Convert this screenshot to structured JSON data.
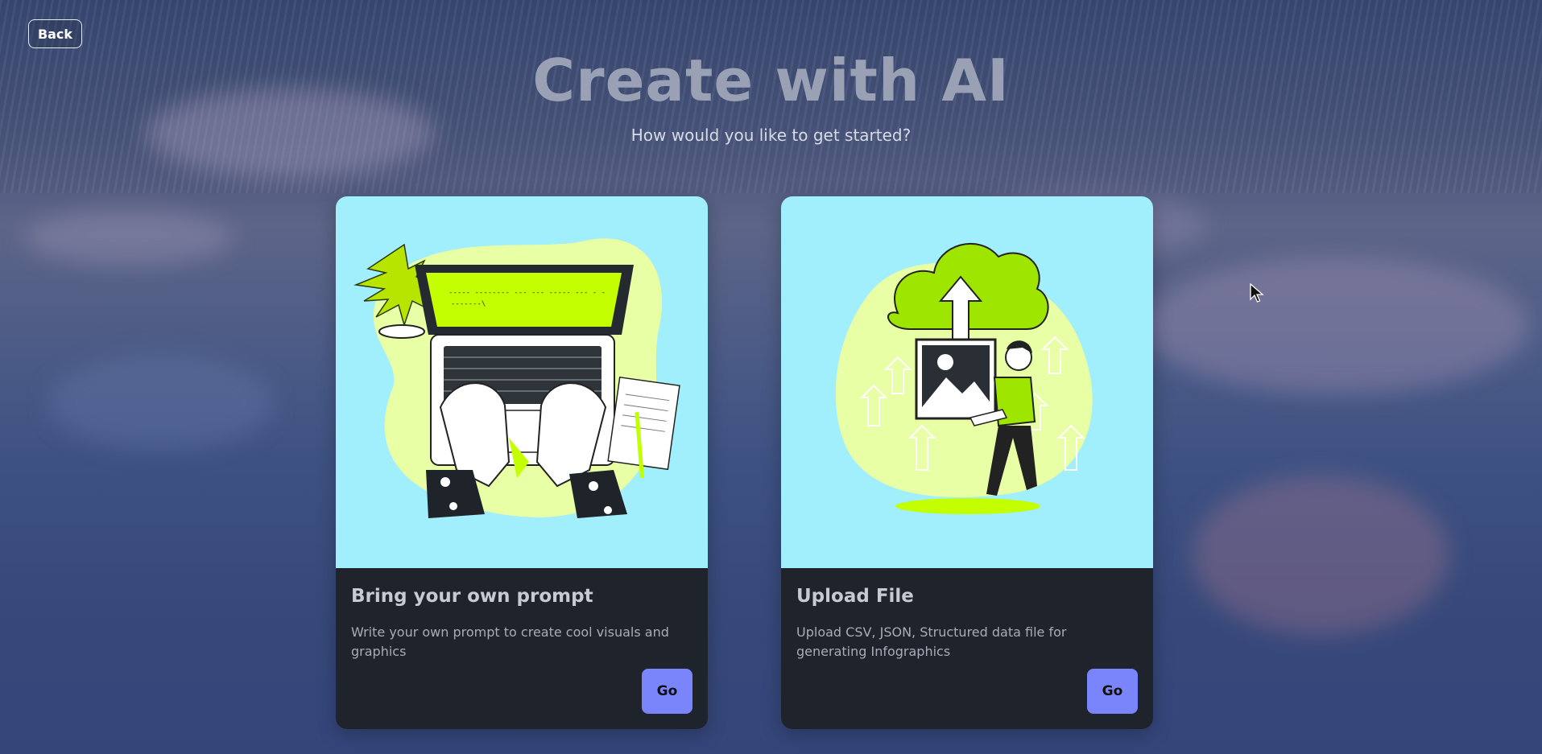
{
  "header": {
    "back_label": "Back",
    "title": "Create with AI",
    "subtitle": "How would you like to get started?"
  },
  "cards": [
    {
      "title": "Bring your own prompt",
      "description": "Write your own prompt to create cool visuals and graphics",
      "button_label": "Go",
      "illustration": "laptop-typing-illustration",
      "screen_text_line1": "----- -------- --- ---    ----- --- - -",
      "screen_text_line2": "-------\\"
    },
    {
      "title": "Upload File",
      "description": "Upload CSV, JSON, Structured data file for generating Infographics",
      "button_label": "Go",
      "illustration": "cloud-upload-illustration"
    }
  ],
  "colors": {
    "card_image_bg": "#a1eefc",
    "card_body_bg": "#1f232b",
    "go_button": "#7b85fb",
    "accent_lime": "#c3ff00",
    "blob_lime": "#e9ffa6"
  }
}
